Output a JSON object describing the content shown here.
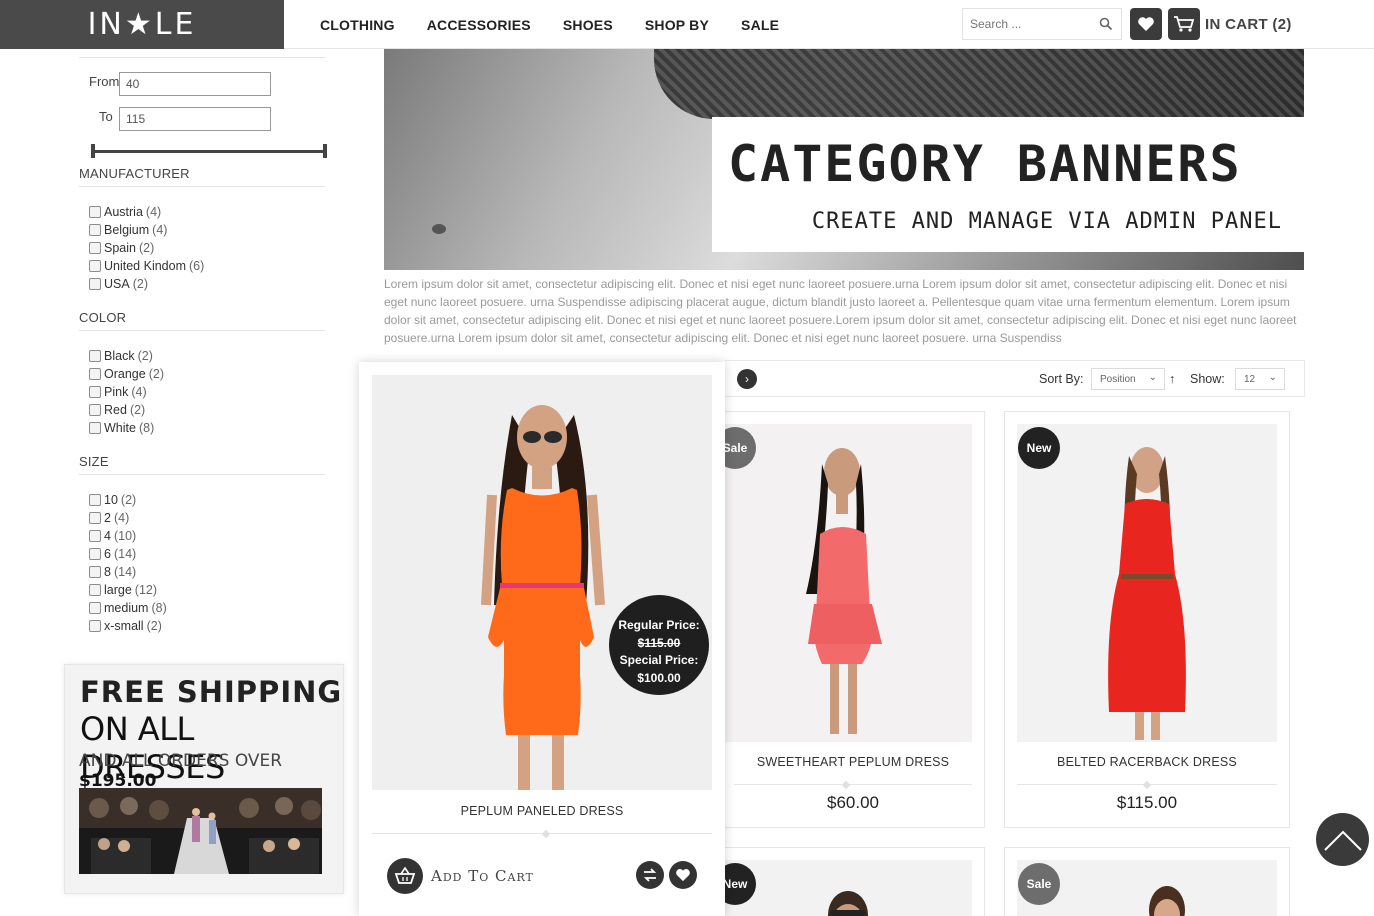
{
  "brand": {
    "logo_text": "IN★LE"
  },
  "nav": {
    "items": [
      "CLOTHING",
      "ACCESSORIES",
      "SHOES",
      "SHOP BY",
      "SALE"
    ]
  },
  "header": {
    "search_placeholder": "Search ...",
    "cart_label": "IN CART (2)"
  },
  "price_filter": {
    "from_label": "From",
    "from_value": "40",
    "to_label": "To",
    "to_value": "115"
  },
  "filters": {
    "manufacturer": {
      "title": "MANUFACTURER",
      "options": [
        {
          "label": "Austria",
          "count": "(4)"
        },
        {
          "label": "Belgium",
          "count": "(4)"
        },
        {
          "label": "Spain",
          "count": "(2)"
        },
        {
          "label": "United Kindom",
          "count": "(6)"
        },
        {
          "label": "USA",
          "count": "(2)"
        }
      ]
    },
    "color": {
      "title": "COLOR",
      "options": [
        {
          "label": "Black",
          "count": "(2)"
        },
        {
          "label": "Orange",
          "count": "(2)"
        },
        {
          "label": "Pink",
          "count": "(4)"
        },
        {
          "label": "Red",
          "count": "(2)"
        },
        {
          "label": "White",
          "count": "(8)"
        }
      ]
    },
    "size": {
      "title": "SIZE",
      "options": [
        {
          "label": "10",
          "count": "(2)"
        },
        {
          "label": "2",
          "count": "(4)"
        },
        {
          "label": "4",
          "count": "(10)"
        },
        {
          "label": "6",
          "count": "(14)"
        },
        {
          "label": "8",
          "count": "(14)"
        },
        {
          "label": "large",
          "count": "(12)"
        },
        {
          "label": "medium",
          "count": "(8)"
        },
        {
          "label": "x-small",
          "count": "(2)"
        }
      ]
    }
  },
  "promo": {
    "line1": "FREE SHIPPING",
    "line2": "ON ALL DRESSES",
    "line3_prefix": "AND ALL ORDERS OVER ",
    "line3_amount": "$195.00"
  },
  "banner": {
    "title": "CATEGORY BANNERS",
    "subtitle": "CREATE AND MANAGE VIA ADMIN PANEL"
  },
  "description": "Lorem ipsum dolor sit amet, consectetur adipiscing elit. Donec et nisi eget nunc laoreet posuere.urna Lorem ipsum dolor sit amet, consectetur adipiscing elit. Donec et nisi eget nunc laoreet posuere. urna Suspendisse adipiscing placerat augue, dictum blandit justo laoreet a. Pellentesque quam vitae urna fermentum elementum. Lorem ipsum dolor sit amet, consectetur adipiscing elit. Donec et nisi eget et nunc laoreet posuere.Lorem ipsum dolor sit amet, consectetur adipiscing elit. Donec et nisi eget nunc laoreet posuere.urna Lorem ipsum dolor sit amet, consectetur adipiscing elit. Donec et nisi eget nunc laoreet posuere. urna Suspendiss",
  "toolbar": {
    "sort_label": "Sort By:",
    "sort_value": "Position",
    "sort_dir": "↑",
    "show_label": "Show:",
    "show_value": "12"
  },
  "products": [
    {
      "name": "PEPLUM PANELED DRESS",
      "regular_label": "Regular Price:",
      "regular_price": "$115.00",
      "special_label": "Special Price:",
      "special_price": "$100.00",
      "add_to_cart": "Add To Cart",
      "dress_color": "#ff6a1a"
    },
    {
      "name": "SWEETHEART PEPLUM DRESS",
      "price": "$60.00",
      "badge": "Sale",
      "dress_color": "#f26a6a"
    },
    {
      "name": "BELTED RACERBACK DRESS",
      "price": "$115.00",
      "badge": "New",
      "dress_color": "#e8261f"
    }
  ],
  "bottom_badges": {
    "left": "New",
    "right": "Sale"
  },
  "colors": {
    "header_dark": "#4a4a4a",
    "accent_dark": "#222222"
  }
}
